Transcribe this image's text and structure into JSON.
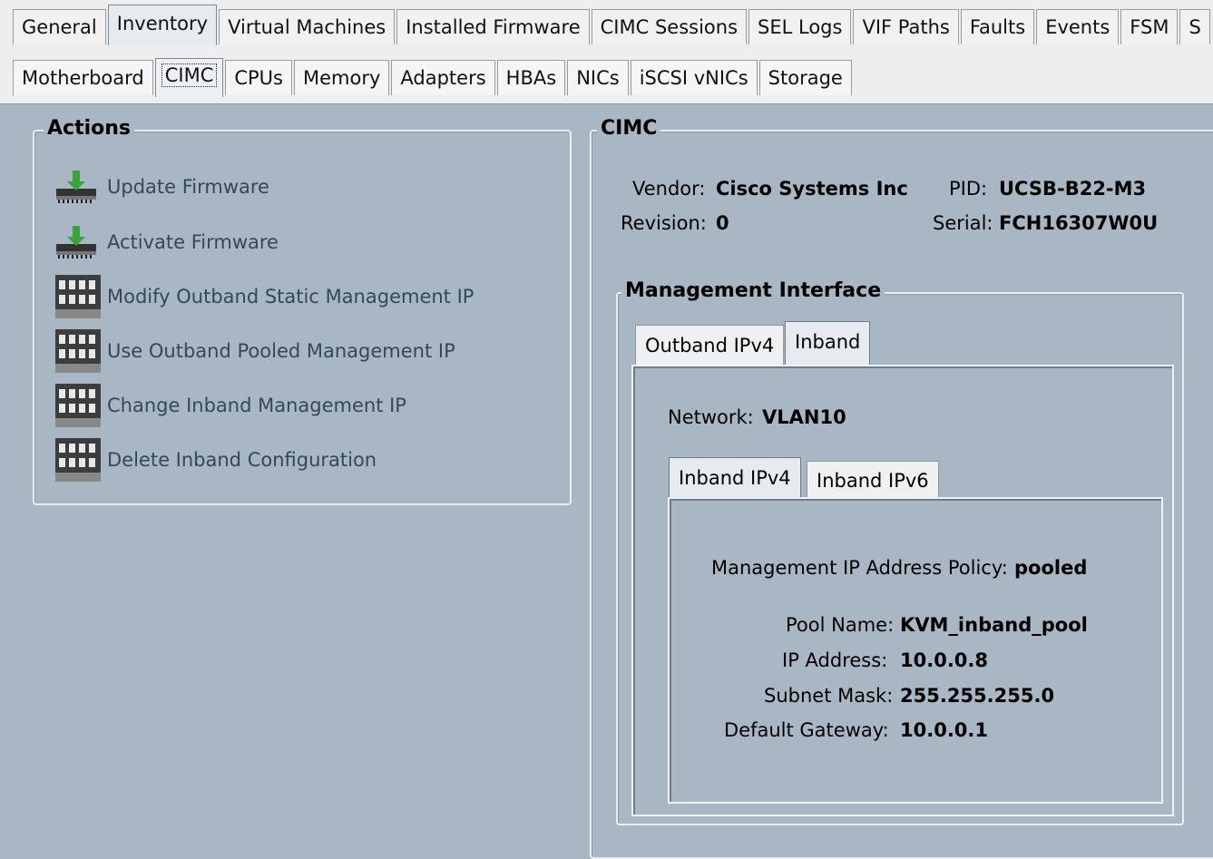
{
  "tabs": [
    "General",
    "Inventory",
    "Virtual Machines",
    "Installed Firmware",
    "CIMC Sessions",
    "SEL Logs",
    "VIF Paths",
    "Faults",
    "Events",
    "FSM",
    "S"
  ],
  "subtabs": [
    "Motherboard",
    "CIMC",
    "CPUs",
    "Memory",
    "Adapters",
    "HBAs",
    "NICs",
    "iSCSI vNICs",
    "Storage"
  ],
  "actions": {
    "title": "Actions",
    "items": [
      {
        "label": "Update Firmware",
        "icon": "download-firmware-icon"
      },
      {
        "label": "Activate Firmware",
        "icon": "download-firmware-icon"
      },
      {
        "label": "Modify Outband Static Management IP",
        "icon": "network-switch-icon"
      },
      {
        "label": "Use Outband Pooled Management IP",
        "icon": "network-switch-icon"
      },
      {
        "label": "Change Inband Management IP",
        "icon": "network-switch-icon"
      },
      {
        "label": "Delete Inband Configuration",
        "icon": "network-switch-icon"
      }
    ]
  },
  "cimc": {
    "title": "CIMC",
    "vendor_label": "Vendor:",
    "vendor": "Cisco Systems Inc",
    "pid_label": "PID:",
    "pid": "UCSB-B22-M3",
    "revision_label": "Revision:",
    "revision": "0",
    "serial_label": "Serial:",
    "serial": "FCH16307W0U"
  },
  "mgmt": {
    "title": "Management Interface",
    "tabs": [
      "Outband IPv4",
      "Inband"
    ],
    "network_label": "Network:",
    "network": "VLAN10",
    "inner_tabs": [
      "Inband IPv4",
      "Inband IPv6"
    ],
    "policy_label": "Management IP Address Policy:",
    "policy": "pooled",
    "pool_label": "Pool Name:",
    "pool": "KVM_inband_pool",
    "ip_label": "IP Address:",
    "ip": "10.0.0.8",
    "mask_label": "Subnet Mask:",
    "mask": "255.255.255.0",
    "gw_label": "Default Gateway:",
    "gw": "10.0.0.1"
  },
  "colors": {
    "background": "#a9b6c3",
    "action_text": "#33475f",
    "tab_bg": "#f1f1f1"
  }
}
